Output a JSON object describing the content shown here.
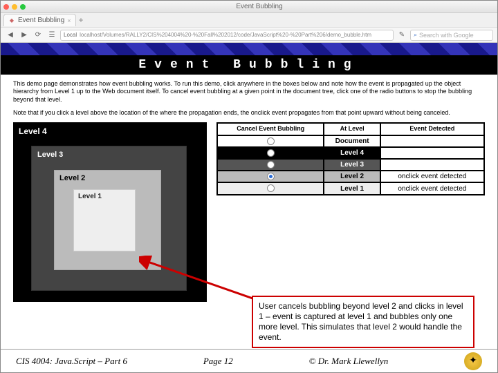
{
  "window": {
    "traffic_red": "",
    "traffic_yellow": "",
    "traffic_green": "",
    "title": "Event Bubbling",
    "tabs": [
      {
        "label": "Event Bubbling"
      }
    ],
    "plus_label": "+",
    "toolbar": {
      "back": "◀",
      "fwd": "▶",
      "reload": "⟳",
      "bookmark": "☰",
      "loc_badge": "Local",
      "address": "localhost/Volumes/RALLY2/CIS%204004%20-%20Fall%202012/code/JavaScript%20-%20Part%206/demo_bubble.htm",
      "reader": "✎",
      "search_placeholder": "Search with Google",
      "search_icon": "⌕"
    }
  },
  "banner": {
    "text": "Event Bubbling"
  },
  "intro": {
    "p1": "This demo page demonstrates how event bubbling works. To run this demo, click anywhere in the boxes below and note how the event is propagated up the object hierarchy from Level 1 up to the Web document itself. To cancel event bubbling at a given point in the document tree, click one of the radio buttons to stop the bubbling beyond that level.",
    "p2": "Note that if you click a level above the location of the where the propagation ends, the onclick event propagates from that point upward without being canceled."
  },
  "levels": {
    "l4": "Level 4",
    "l3": "Level 3",
    "l2": "Level 2",
    "l1": "Level 1"
  },
  "evtable": {
    "head": {
      "c0": "Cancel Event Bubbling",
      "c1": "At Level",
      "c2": "Event Detected"
    },
    "rows": [
      {
        "level": "Document",
        "selected": false,
        "event": ""
      },
      {
        "level": "Level 4",
        "selected": false,
        "event": ""
      },
      {
        "level": "Level 3",
        "selected": false,
        "event": ""
      },
      {
        "level": "Level 2",
        "selected": true,
        "event": "onclick event detected"
      },
      {
        "level": "Level 1",
        "selected": false,
        "event": "onclick event detected"
      }
    ]
  },
  "callout": {
    "text": "User cancels bubbling beyond level 2 and clicks in level 1 – event is captured at level 1 and bubbles only one more level.  This simulates that level 2 would handle the event."
  },
  "footer": {
    "left": "CIS 4004: Java.Script – Part 6",
    "center": "Page 12",
    "right": "© Dr. Mark Llewellyn",
    "logo": "✦"
  }
}
